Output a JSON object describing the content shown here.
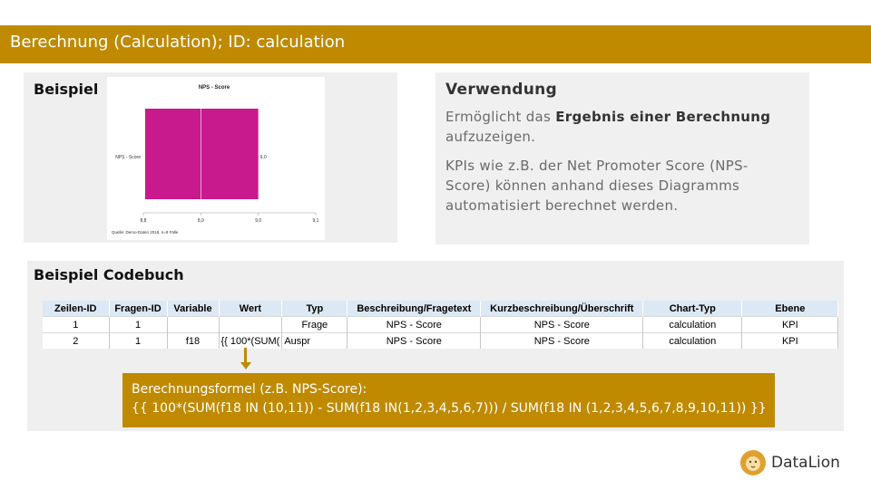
{
  "header": {
    "title": "Berechnung (Calculation); ID: calculation"
  },
  "example": {
    "heading": "Beispiel",
    "chart_data": {
      "type": "bar",
      "title": "NPS - Score",
      "categories": [
        "NPS - Score"
      ],
      "values": [
        9.0
      ],
      "value_label": "9,0",
      "xlim": [
        8.8,
        9.1
      ],
      "x_ticks": [
        "8,8",
        "8,9",
        "9,0",
        "9,1"
      ],
      "source": "Quelle: Demo-Daten 2018, n=9 Fälle",
      "bar_color": "#c81a8c"
    }
  },
  "usage": {
    "heading": "Verwendung",
    "p1_pre": "Ermöglicht das ",
    "p1_bold": "Ergebnis einer Berechnung",
    "p1_post": "aufzuzeigen.",
    "p2": "KPIs wie z.B. der Net Promoter Score (NPS-Score) können anhand dieses Diagramms automatisiert berechnet werden."
  },
  "codebook": {
    "heading": "Beispiel Codebuch",
    "columns": [
      "Zeilen-ID",
      "Fragen-ID",
      "Variable",
      "Wert",
      "Typ",
      "Beschreibung/Fragetext",
      "Kurzbeschreibung/Überschrift",
      "Chart-Typ",
      "Ebene"
    ],
    "rows": [
      [
        "1",
        "1",
        "",
        "",
        "Frage",
        "NPS - Score",
        "NPS - Score",
        "calculation",
        "KPI"
      ],
      [
        "2",
        "1",
        "f18",
        "{{ 100*(SUM(",
        "Auspr",
        "NPS - Score",
        "NPS - Score",
        "calculation",
        "KPI"
      ]
    ]
  },
  "formula": {
    "label": "Berechnungsformel (z.B. NPS-Score):",
    "text": "{{ 100*(SUM(f18 IN (10,11)) - SUM(f18 IN(1,2,3,4,5,6,7))) / SUM(f18 IN (1,2,3,4,5,6,7,8,9,10,11)) }}"
  },
  "brand": {
    "name": "DataLion",
    "accent": "#c08a00"
  }
}
